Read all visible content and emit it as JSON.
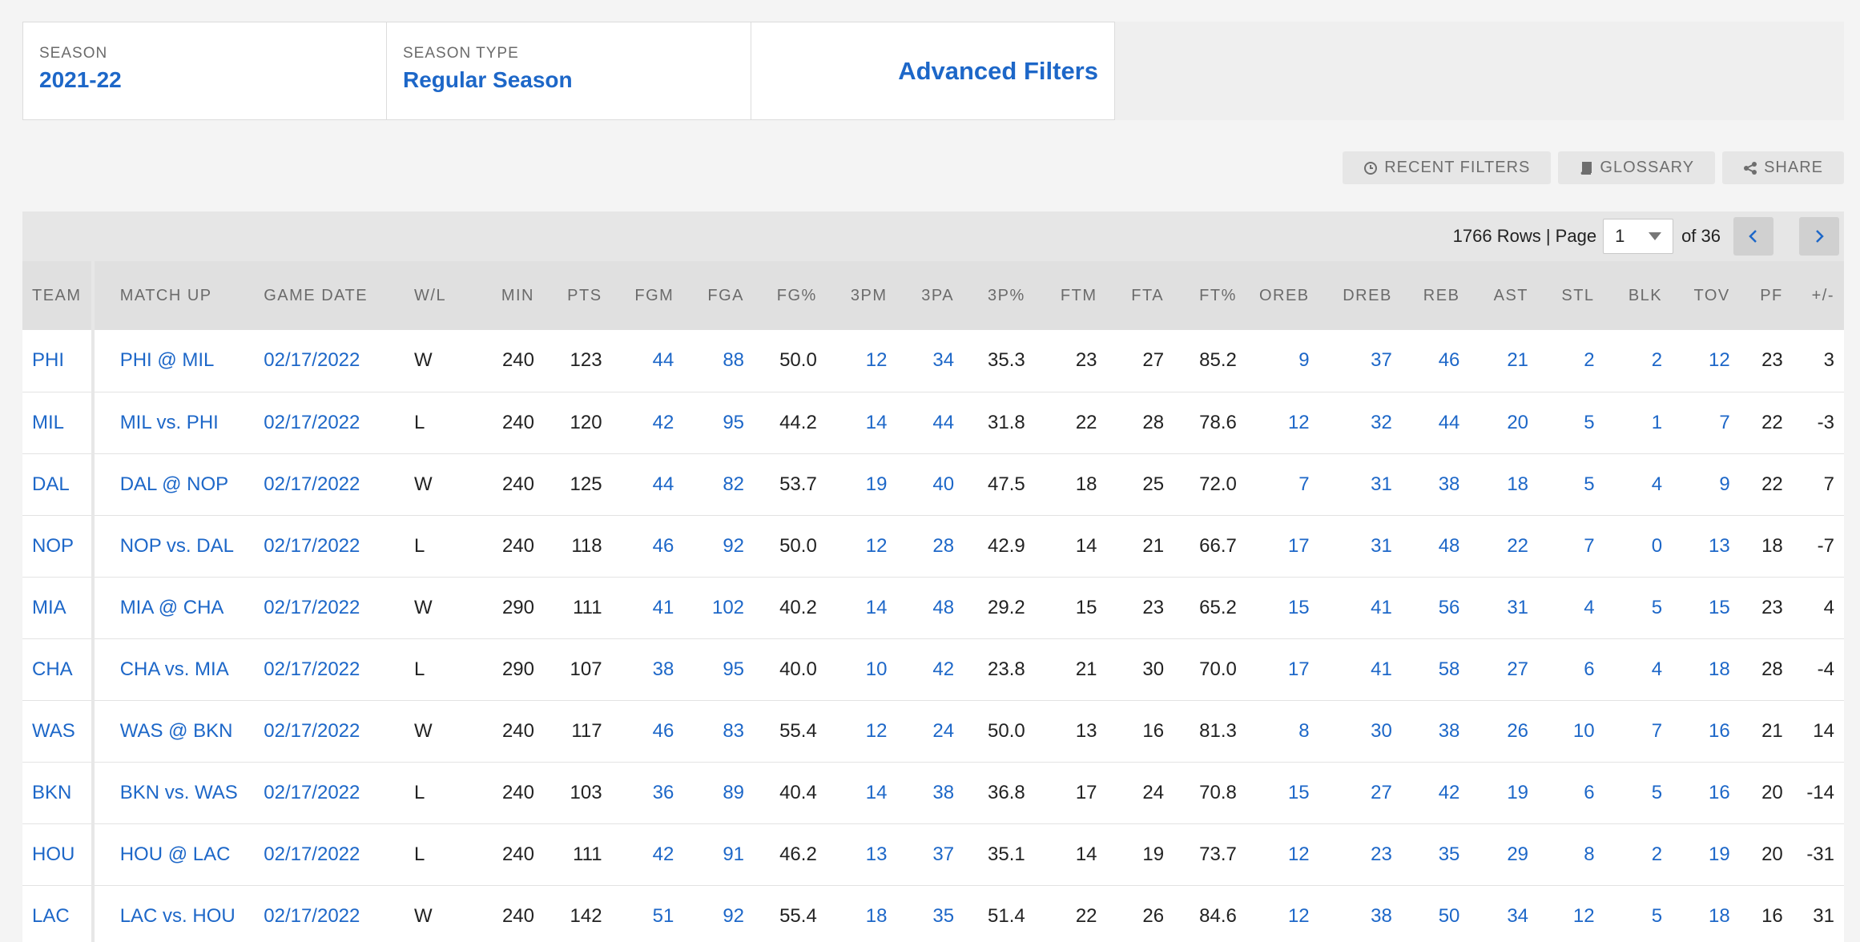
{
  "filters": {
    "season": {
      "label": "SEASON",
      "value": "2021-22"
    },
    "season_type": {
      "label": "SEASON TYPE",
      "value": "Regular Season"
    },
    "advanced": "Advanced Filters"
  },
  "toolbar": {
    "recent_filters": "RECENT FILTERS",
    "glossary": "GLOSSARY",
    "share": "SHARE"
  },
  "pager": {
    "rows_text": "1766 Rows | Page",
    "current_page": "1",
    "of_text": "of 36"
  },
  "columns": [
    "TEAM",
    "MATCH UP",
    "GAME DATE",
    "W/L",
    "MIN",
    "PTS",
    "FGM",
    "FGA",
    "FG%",
    "3PM",
    "3PA",
    "3P%",
    "FTM",
    "FTA",
    "FT%",
    "OREB",
    "DREB",
    "REB",
    "AST",
    "STL",
    "BLK",
    "TOV",
    "PF",
    "+/-"
  ],
  "rows": [
    [
      "PHI",
      "PHI @ MIL",
      "02/17/2022",
      "W",
      "240",
      "123",
      "44",
      "88",
      "50.0",
      "12",
      "34",
      "35.3",
      "23",
      "27",
      "85.2",
      "9",
      "37",
      "46",
      "21",
      "2",
      "2",
      "12",
      "23",
      "3"
    ],
    [
      "MIL",
      "MIL vs. PHI",
      "02/17/2022",
      "L",
      "240",
      "120",
      "42",
      "95",
      "44.2",
      "14",
      "44",
      "31.8",
      "22",
      "28",
      "78.6",
      "12",
      "32",
      "44",
      "20",
      "5",
      "1",
      "7",
      "22",
      "-3"
    ],
    [
      "DAL",
      "DAL @ NOP",
      "02/17/2022",
      "W",
      "240",
      "125",
      "44",
      "82",
      "53.7",
      "19",
      "40",
      "47.5",
      "18",
      "25",
      "72.0",
      "7",
      "31",
      "38",
      "18",
      "5",
      "4",
      "9",
      "22",
      "7"
    ],
    [
      "NOP",
      "NOP vs. DAL",
      "02/17/2022",
      "L",
      "240",
      "118",
      "46",
      "92",
      "50.0",
      "12",
      "28",
      "42.9",
      "14",
      "21",
      "66.7",
      "17",
      "31",
      "48",
      "22",
      "7",
      "0",
      "13",
      "18",
      "-7"
    ],
    [
      "MIA",
      "MIA @ CHA",
      "02/17/2022",
      "W",
      "290",
      "111",
      "41",
      "102",
      "40.2",
      "14",
      "48",
      "29.2",
      "15",
      "23",
      "65.2",
      "15",
      "41",
      "56",
      "31",
      "4",
      "5",
      "15",
      "23",
      "4"
    ],
    [
      "CHA",
      "CHA vs. MIA",
      "02/17/2022",
      "L",
      "290",
      "107",
      "38",
      "95",
      "40.0",
      "10",
      "42",
      "23.8",
      "21",
      "30",
      "70.0",
      "17",
      "41",
      "58",
      "27",
      "6",
      "4",
      "18",
      "28",
      "-4"
    ],
    [
      "WAS",
      "WAS @ BKN",
      "02/17/2022",
      "W",
      "240",
      "117",
      "46",
      "83",
      "55.4",
      "12",
      "24",
      "50.0",
      "13",
      "16",
      "81.3",
      "8",
      "30",
      "38",
      "26",
      "10",
      "7",
      "16",
      "21",
      "14"
    ],
    [
      "BKN",
      "BKN vs. WAS",
      "02/17/2022",
      "L",
      "240",
      "103",
      "36",
      "89",
      "40.4",
      "14",
      "38",
      "36.8",
      "17",
      "24",
      "70.8",
      "15",
      "27",
      "42",
      "19",
      "6",
      "5",
      "16",
      "20",
      "-14"
    ],
    [
      "HOU",
      "HOU @ LAC",
      "02/17/2022",
      "L",
      "240",
      "111",
      "42",
      "91",
      "46.2",
      "13",
      "37",
      "35.1",
      "14",
      "19",
      "73.7",
      "12",
      "23",
      "35",
      "29",
      "8",
      "2",
      "19",
      "20",
      "-31"
    ],
    [
      "LAC",
      "LAC vs. HOU",
      "02/17/2022",
      "W",
      "240",
      "142",
      "51",
      "92",
      "55.4",
      "18",
      "35",
      "51.4",
      "22",
      "26",
      "84.6",
      "12",
      "38",
      "50",
      "34",
      "12",
      "5",
      "18",
      "16",
      "31"
    ]
  ]
}
